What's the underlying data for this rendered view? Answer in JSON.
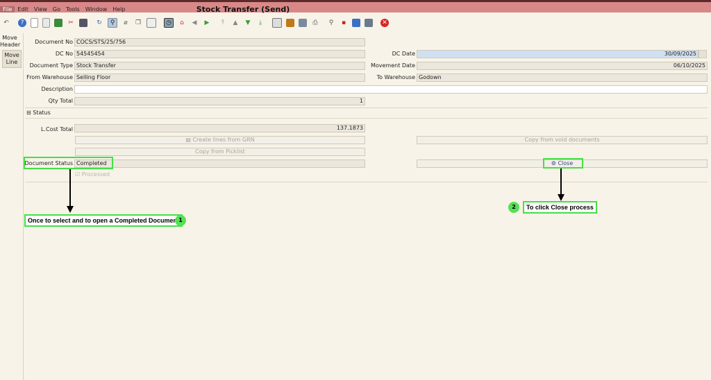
{
  "window": {
    "title": "Stock Transfer (Send)"
  },
  "menu": [
    "File",
    "Edit",
    "View",
    "Go",
    "Tools",
    "Window",
    "Help"
  ],
  "toolbar_icons": [
    "undo-icon",
    "help-icon",
    "new-icon",
    "copy-icon",
    "save-icon",
    "delete-icon",
    "save-create-icon",
    "refresh-icon",
    "find-icon",
    "attachment-icon",
    "chat-icon",
    "report-icon",
    "history-icon",
    "home-icon",
    "back-icon",
    "forward-icon",
    "first-icon",
    "previous-icon",
    "next-icon",
    "last-icon",
    "print-preview-icon",
    "print-icon",
    "archive-icon",
    "zoom-icon",
    "translate-icon",
    "workflow-icon",
    "product-info-icon",
    "window-icon",
    "end-icon"
  ],
  "nav": {
    "item1": "Move Header",
    "item2": "Move Line"
  },
  "form": {
    "document_no_label": "Document No",
    "document_no": "COCS/STS/25/756",
    "dc_no_label": "DC No",
    "dc_no": "54545454",
    "dc_date_label": "DC Date",
    "dc_date": "30/09/2025",
    "document_type_label": "Document Type",
    "document_type": "Stock Transfer",
    "movement_date_label": "Movement Date",
    "movement_date": "06/10/2025",
    "from_warehouse_label": "From Warehouse",
    "from_warehouse": "Selling Floor",
    "to_warehouse_label": "To Warehouse",
    "to_warehouse": "Godown",
    "description_label": "Description",
    "description": "",
    "qty_total_label": "Qty Total",
    "qty_total": "1",
    "status_section": "Status",
    "lcost_total_label": "L.Cost Total",
    "lcost_total": "137.1873",
    "create_lines_label": "Create lines from GRN",
    "copy_void_label": "Copy from void documents",
    "copy_picklist_label": "Copy from Picklist",
    "document_status_label": "Document Status",
    "document_status": "Completed",
    "close_label": "Close",
    "processed_label": "Processed"
  },
  "annotations": {
    "callout1": "Once to select and to open a Completed Document",
    "badge1": "1",
    "callout2": "To click Close process",
    "badge2": "2"
  },
  "colors": {
    "titlebar": "#d98888",
    "highlight": "#44e044",
    "field": "#ebe7dd",
    "date_field": "#cfe0f2"
  }
}
